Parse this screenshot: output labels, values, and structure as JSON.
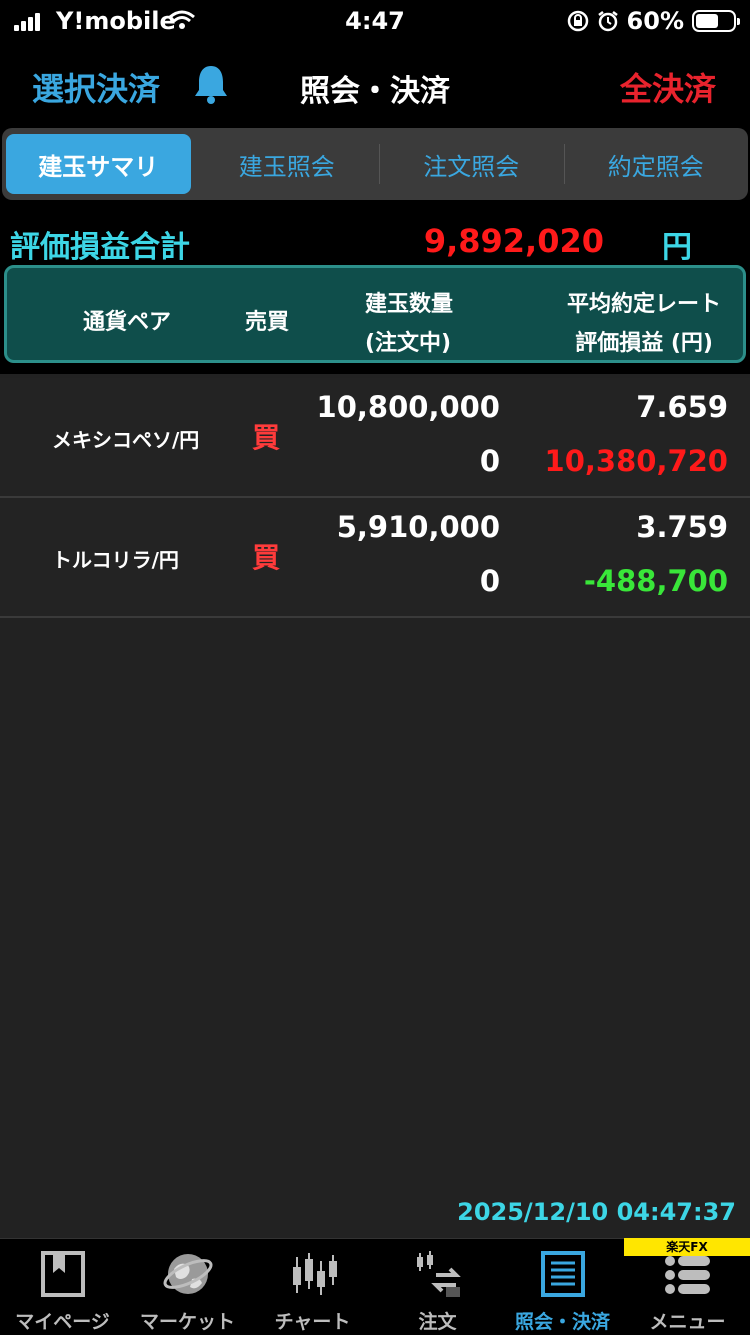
{
  "status": {
    "carrier": "Y!mobile",
    "time": "4:47",
    "battery": "60%"
  },
  "nav": {
    "left_button": "選択決済",
    "title": "照会・決済",
    "right_button": "全決済"
  },
  "tabs": [
    "建玉サマリ",
    "建玉照会",
    "注文照会",
    "約定照会"
  ],
  "summary": {
    "label": "評価損益合計",
    "value": "9,892,020",
    "unit": "円"
  },
  "table_header": {
    "pair": "通貨ペア",
    "side": "売買",
    "qty": "建玉数量",
    "pending": "(注文中)",
    "rate": "平均約定レート",
    "pl": "評価損益 (円)"
  },
  "rows": [
    {
      "pair": "メキシコペソ/円",
      "side": "買",
      "qty": "10,800,000",
      "pending": "0",
      "rate": "7.659",
      "pl": "10,380,720",
      "pl_color": "#ff1a1a"
    },
    {
      "pair": "トルコリラ/円",
      "side": "買",
      "qty": "5,910,000",
      "pending": "0",
      "rate": "3.759",
      "pl": "-488,700",
      "pl_color": "#39e639"
    }
  ],
  "timestamp": "2025/12/10 04:47:37",
  "badge": "楽天FX",
  "tabbar": [
    {
      "label": "マイページ",
      "icon": "bookmark-icon"
    },
    {
      "label": "マーケット",
      "icon": "globe-icon"
    },
    {
      "label": "チャート",
      "icon": "candlestick-icon"
    },
    {
      "label": "注文",
      "icon": "order-icon"
    },
    {
      "label": "照会・決済",
      "icon": "list-icon"
    },
    {
      "label": "メニュー",
      "icon": "menu-icon"
    }
  ],
  "colors": {
    "accent": "#3aa7e0",
    "danger": "#e8232d",
    "teal": "#3dd6e6"
  }
}
